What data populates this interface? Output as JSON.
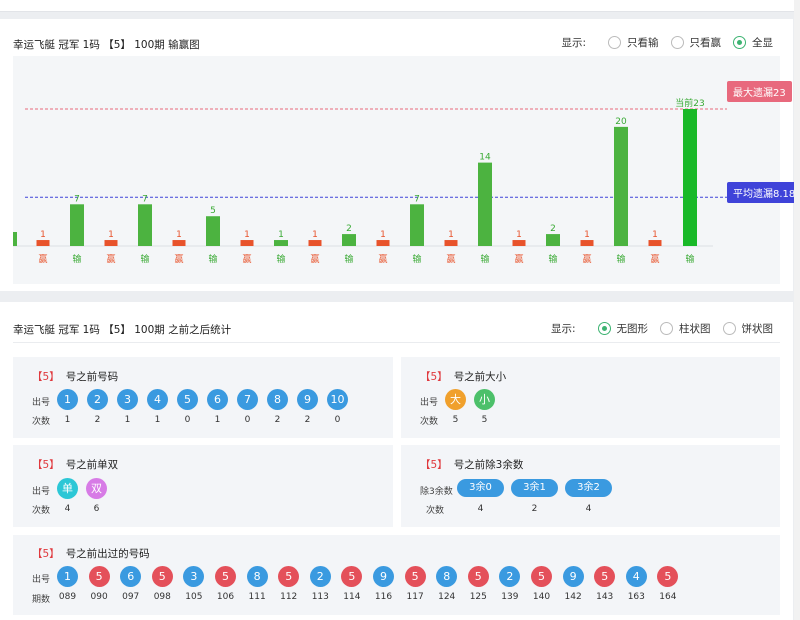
{
  "panel1": {
    "title": "幸运飞艇 冠军 1码 【5】 100期 输赢图",
    "display_label": "显示:",
    "options": [
      "只看输",
      "只看赢",
      "全显"
    ],
    "selected": 2
  },
  "chart_data": {
    "type": "bar",
    "categories": [
      "赢",
      "输",
      "赢",
      "输",
      "赢",
      "输",
      "赢",
      "输",
      "赢",
      "输",
      "赢",
      "输",
      "赢",
      "输",
      "赢",
      "输",
      "赢",
      "输",
      "赢",
      "输"
    ],
    "values": [
      1,
      7,
      1,
      7,
      1,
      5,
      1,
      1,
      1,
      2,
      1,
      7,
      1,
      14,
      1,
      2,
      1,
      20,
      1,
      23
    ],
    "data_labels": [
      "1",
      "7",
      "1",
      "7",
      "1",
      "5",
      "1",
      "1",
      "1",
      "2",
      "1",
      "7",
      "1",
      "14",
      "1",
      "2",
      "1",
      "20",
      "1",
      "当前23"
    ],
    "ylim": [
      0,
      23
    ],
    "reference_lines": [
      {
        "label": "最大遗漏23",
        "value": 23,
        "color": "#e8697d"
      },
      {
        "label": "平均遗漏8.18",
        "value": 8.18,
        "color": "#3f43d9"
      }
    ],
    "colors": {
      "win": "#e8532b",
      "lose": "#4cb340",
      "current": "#19b928",
      "win_text": "#e8532b",
      "lose_text": "#3aaa35"
    }
  },
  "panel2": {
    "title": "幸运飞艇 冠军 1码 【5】 100期 之前之后统计",
    "display_label": "显示:",
    "options": [
      "无图形",
      "柱状图",
      "饼状图"
    ],
    "selected": 0
  },
  "before_numbers": {
    "bracket": "【5】",
    "title": "号之前号码",
    "row1": "出号",
    "row2": "次数",
    "balls": [
      "1",
      "2",
      "3",
      "4",
      "5",
      "6",
      "7",
      "8",
      "9",
      "10"
    ],
    "counts": [
      "1",
      "2",
      "1",
      "1",
      "0",
      "1",
      "0",
      "2",
      "2",
      "0"
    ]
  },
  "before_size": {
    "bracket": "【5】",
    "title": "号之前大小",
    "row1": "出号",
    "row2": "次数",
    "balls": [
      "大",
      "小"
    ],
    "counts": [
      "5",
      "5"
    ]
  },
  "before_parity": {
    "bracket": "【5】",
    "title": "号之前单双",
    "row1": "出号",
    "row2": "次数",
    "balls": [
      "单",
      "双"
    ],
    "counts": [
      "4",
      "6"
    ]
  },
  "before_mod3": {
    "bracket": "【5】",
    "title": "号之前除3余数",
    "row1": "除3余数",
    "row2": "次数",
    "pills": [
      "3余0",
      "3余1",
      "3余2"
    ],
    "counts": [
      "4",
      "2",
      "4"
    ]
  },
  "history": {
    "bracket": "【5】",
    "title": "号之前出过的号码",
    "row1": "出号",
    "row2": "期数",
    "balls": [
      "1",
      "5",
      "6",
      "5",
      "3",
      "5",
      "8",
      "5",
      "2",
      "5",
      "9",
      "5",
      "8",
      "5",
      "2",
      "5",
      "9",
      "5",
      "4",
      "5"
    ],
    "periods": [
      "089",
      "090",
      "097",
      "098",
      "105",
      "106",
      "111",
      "112",
      "113",
      "114",
      "116",
      "117",
      "124",
      "125",
      "139",
      "140",
      "142",
      "143",
      "163",
      "164"
    ]
  }
}
